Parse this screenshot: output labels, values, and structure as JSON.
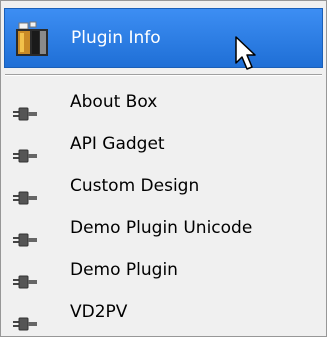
{
  "menu": {
    "header": {
      "label": "Plugin Info",
      "icon": "plugin-info-icon"
    },
    "items": [
      {
        "label": "About Box",
        "icon": "plug-icon"
      },
      {
        "label": "API Gadget",
        "icon": "plug-icon"
      },
      {
        "label": "Custom Design",
        "icon": "plug-icon"
      },
      {
        "label": "Demo Plugin Unicode",
        "icon": "plug-icon"
      },
      {
        "label": "Demo Plugin",
        "icon": "plug-icon"
      },
      {
        "label": "VD2PV",
        "icon": "plug-icon"
      }
    ]
  },
  "colors": {
    "highlight": "#2f80e7",
    "menu_background": "#f0f0f0",
    "highlight_text": "#ffffff"
  }
}
